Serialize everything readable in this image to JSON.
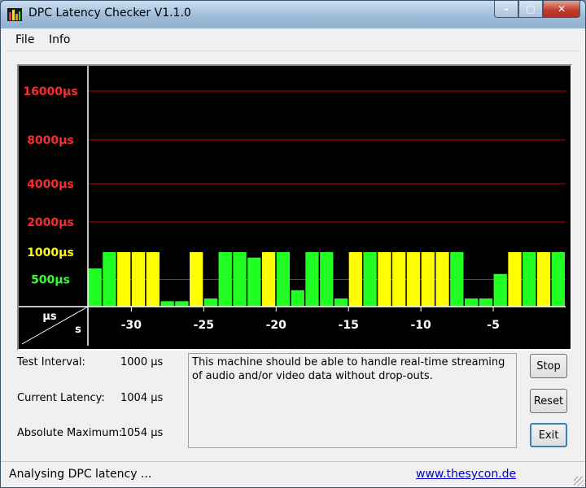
{
  "window": {
    "title": "DPC Latency Checker V1.1.0",
    "minimize": "–",
    "maximize": "□",
    "close": "✕"
  },
  "menu": [
    {
      "label": "File"
    },
    {
      "label": "Info"
    }
  ],
  "chart_data": {
    "type": "bar",
    "y_axis_unit_label": "µs",
    "x_axis_unit_label": "s",
    "y_levels": [
      {
        "label": "16000µs",
        "value": 16000,
        "color": "#ff2a2a"
      },
      {
        "label": "8000µs",
        "value": 8000,
        "color": "#ff2a2a"
      },
      {
        "label": "4000µs",
        "value": 4000,
        "color": "#ff2a2a"
      },
      {
        "label": "2000µs",
        "value": 2000,
        "color": "#ff2a2a"
      },
      {
        "label": "1000µs",
        "value": 1000,
        "color": "#ffff00"
      },
      {
        "label": "500µs",
        "value": 500,
        "color": "#33ff33"
      }
    ],
    "x_ticks": [
      -30,
      -25,
      -20,
      -15,
      -10,
      -5
    ],
    "x_range": [
      -33,
      0
    ],
    "values": [
      700,
      1000,
      1000,
      1000,
      1000,
      100,
      100,
      1000,
      150,
      1000,
      1000,
      900,
      1000,
      1000,
      300,
      1000,
      1000,
      150,
      1000,
      1000,
      1000,
      1000,
      1000,
      1000,
      1000,
      1000,
      150,
      150,
      600,
      1000,
      1000,
      1000,
      1000
    ],
    "colors": [
      "#22ff22",
      "#22ff22",
      "#ffff00",
      "#ffff00",
      "#ffff00",
      "#22ff22",
      "#22ff22",
      "#ffff00",
      "#22ff22",
      "#22ff22",
      "#22ff22",
      "#22ff22",
      "#ffff00",
      "#22ff22",
      "#22ff22",
      "#22ff22",
      "#22ff22",
      "#22ff22",
      "#ffff00",
      "#22ff22",
      "#ffff00",
      "#ffff00",
      "#ffff00",
      "#ffff00",
      "#ffff00",
      "#22ff22",
      "#22ff22",
      "#22ff22",
      "#22ff22",
      "#ffff00",
      "#22ff22",
      "#ffff00",
      "#22ff22"
    ],
    "grid_color": "#cc0000",
    "background": "#000000"
  },
  "info": {
    "test_interval": {
      "label": "Test Interval:",
      "value": "1000 µs"
    },
    "current_latency": {
      "label": "Current Latency:",
      "value": "1004 µs"
    },
    "absolute_maximum": {
      "label": "Absolute Maximum:",
      "value": "1054 µs"
    }
  },
  "message": "This machine should be able to handle real-time streaming of audio and/or video data without drop-outs.",
  "buttons": {
    "stop": "Stop",
    "reset": "Reset",
    "exit": "Exit"
  },
  "status": {
    "text": "Analysing DPC latency ...",
    "link": "www.thesycon.de"
  }
}
